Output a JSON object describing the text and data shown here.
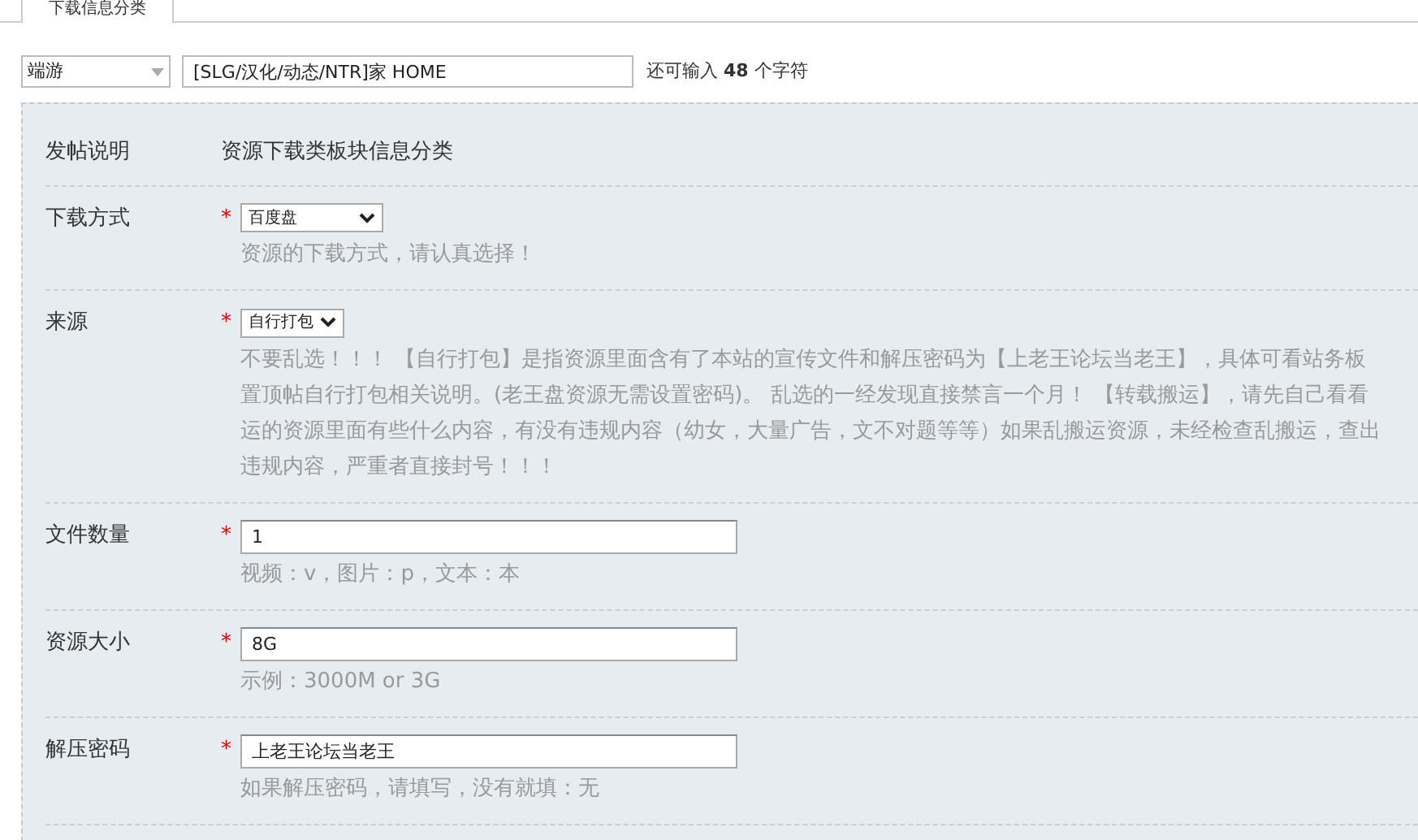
{
  "tabs": [
    {
      "label": "下载信息分类",
      "selected": true
    }
  ],
  "title_row": {
    "category": "端游",
    "subject": "[SLG/汉化/动态/NTR]家 HOME",
    "remaining": "还可输入 **48** 个字符"
  },
  "rows": [
    {
      "kind": "info",
      "label": "发帖说明",
      "value": "资源下载类板块信息分类"
    },
    {
      "kind": "select",
      "label": "下载方式",
      "required": "*",
      "value": "百度盘",
      "hint_lines": [
        "资源的下载方式，请认真选择！"
      ]
    },
    {
      "kind": "select",
      "label": "来源",
      "required": "*",
      "value": "自行打包",
      "hint_lines": [
        "不要乱选！！！ 【自行打包】是指资源里面含有了本站的宣传文件和解压密码为【上老王论坛当老王】，具体可看站务板",
        "置顶帖自行打包相关说明。(老王盘资源无需设置密码)。 乱选的一经发现直接禁言一个月！ 【转载搬运】，请先自己看看",
        "运的资源里面有些什么内容，有没有违规内容（幼女，大量广告，文不对题等等）如果乱搬运资源，未经检查乱搬运，查出",
        "违规内容，严重者直接封号！！！"
      ]
    },
    {
      "kind": "input",
      "label": "文件数量",
      "required": "*",
      "value": "1",
      "hint_lines": [
        "视频：v，图片：p，文本：本"
      ]
    },
    {
      "kind": "input",
      "label": "资源大小",
      "required": "*",
      "value": "8G",
      "hint_lines": [
        "示例：3000M or 3G"
      ]
    },
    {
      "kind": "input",
      "label": "解压密码",
      "required": "*",
      "value": "上老王论坛当老王",
      "hint_lines": [
        "如果解压密码，请填写，没有就填：无"
      ]
    }
  ]
}
